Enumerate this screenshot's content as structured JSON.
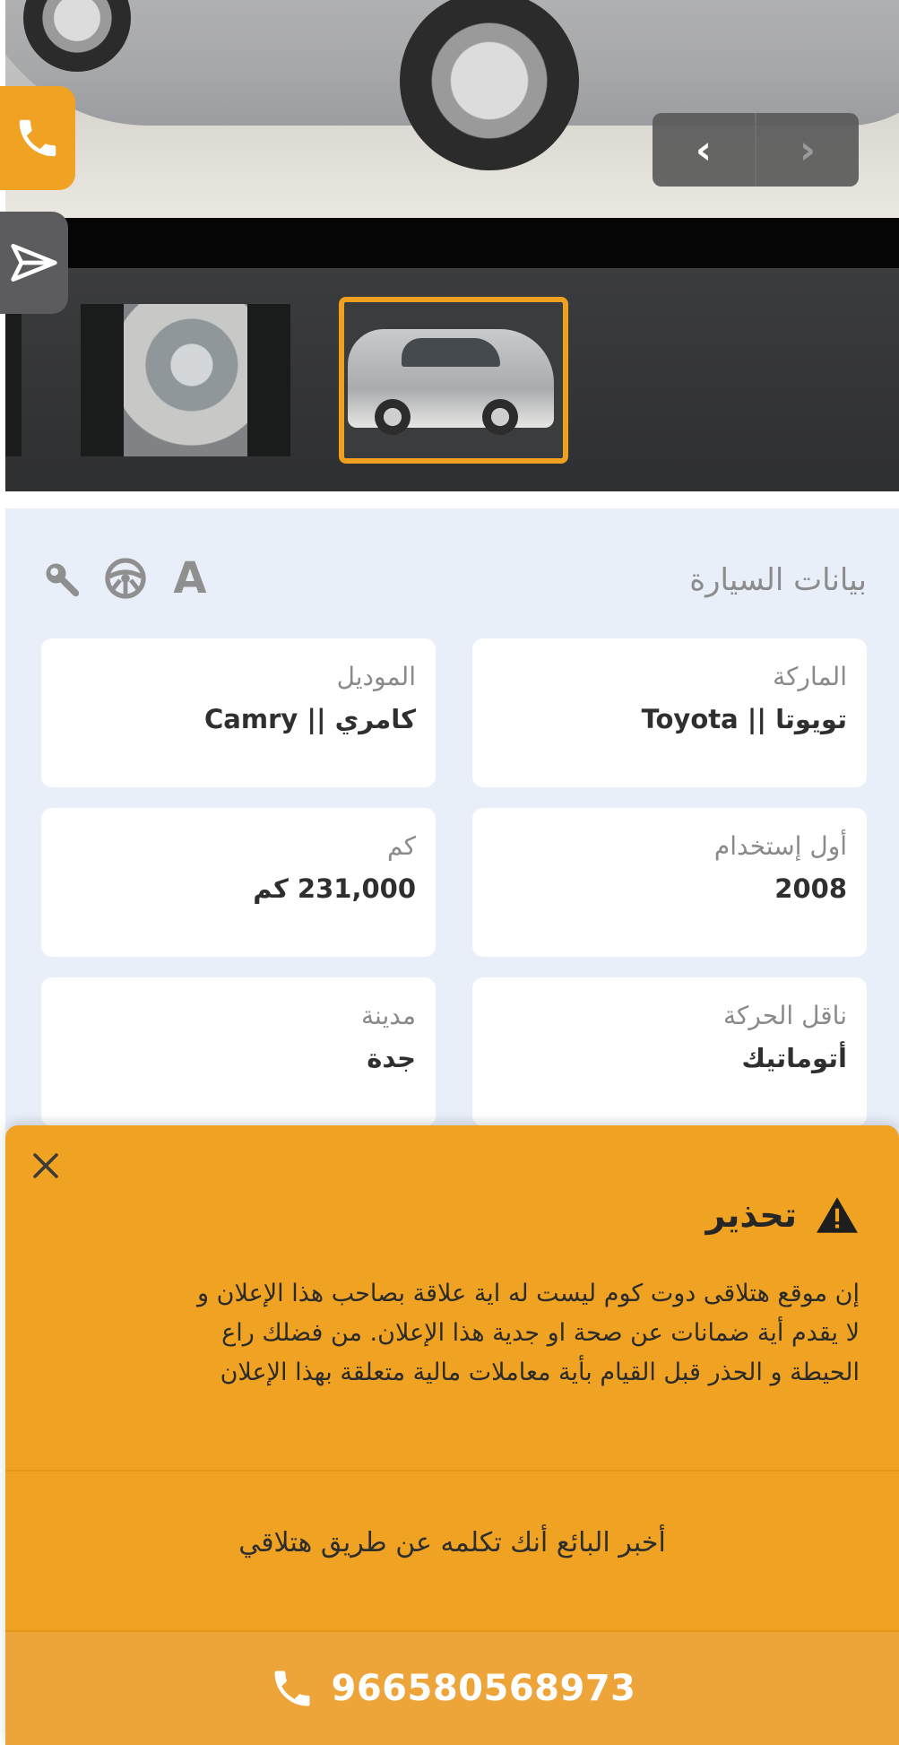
{
  "gallery": {
    "nav": {
      "prev_icon": "chevron-left-icon",
      "next_icon": "chevron-right-icon"
    },
    "floating": {
      "call_icon": "phone-icon",
      "share_icon": "share-icon"
    }
  },
  "car_info": {
    "title": "بيانات السيارة",
    "header_icons": [
      "font-a-icon",
      "steering-wheel-icon",
      "wrench-icon"
    ],
    "fields": [
      {
        "label": "الماركة",
        "value": "تويوتا || Toyota"
      },
      {
        "label": "الموديل",
        "value": "كامري || Camry"
      },
      {
        "label": "أول إستخدام",
        "value": "2008"
      },
      {
        "label": "كم",
        "value": "231,000 كم"
      },
      {
        "label": "ناقل الحركة",
        "value": "أتوماتيك"
      },
      {
        "label": "مدينة",
        "value": "جدة"
      }
    ]
  },
  "warning": {
    "title": "تحذير",
    "body_lines": [
      "إن موقع هتلاقى دوت كوم ليست له اية علاقة بصاحب هذا الإعلان و",
      "لا يقدم أية ضمانات عن صحة او جدية هذا الإعلان. من فضلك راع",
      "الحيطة و الحذر قبل القيام بأية معاملات مالية متعلقة بهذا الإعلان"
    ],
    "tell_seller": "أخبر البائع أنك تكلمه عن طريق هتلاقي",
    "phone": "966580568973"
  },
  "colors": {
    "accent": "#f0a323",
    "section_bg": "#e8eff9",
    "thumb_border": "#f0a020",
    "text_dark": "#2f2f2f",
    "text_muted": "#8a8a8a"
  }
}
